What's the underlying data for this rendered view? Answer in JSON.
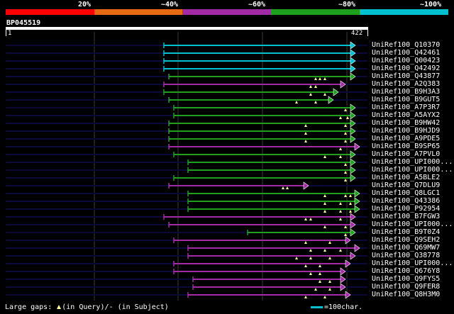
{
  "scale": {
    "labels": [
      "20%",
      "~40%",
      "~60%",
      "~80%",
      "~100%"
    ],
    "colors": [
      "#ff0000",
      "#e66a14",
      "#a32aa5",
      "#1ea01e",
      "#00bfcf"
    ]
  },
  "query": {
    "id": "BP045519",
    "start": "1",
    "end": "422",
    "length": 422
  },
  "hits": [
    {
      "name": "UniRef100_Q10370",
      "color": "#00bfcf",
      "start": 231,
      "end": 494,
      "gaps": []
    },
    {
      "name": "UniRef100_Q42461",
      "color": "#00bfcf",
      "start": 231,
      "end": 494,
      "gaps": []
    },
    {
      "name": "UniRef100_Q00423",
      "color": "#00bfcf",
      "start": 231,
      "end": 494,
      "gaps": []
    },
    {
      "name": "UniRef100_Q42492",
      "color": "#00bfcf",
      "start": 231,
      "end": 494,
      "gaps": []
    },
    {
      "name": "UniRef100_Q43877",
      "color": "#1ea01e",
      "start": 238,
      "end": 494,
      "gaps": [
        445,
        451,
        458
      ]
    },
    {
      "name": "UniRef100_A2Q383",
      "color": "#a32aa5",
      "start": 231,
      "end": 480,
      "gaps": [
        438,
        445
      ]
    },
    {
      "name": "UniRef100_B9H3A3",
      "color": "#1ea01e",
      "start": 231,
      "end": 470,
      "gaps": [
        438,
        458
      ]
    },
    {
      "name": "UniRef100_B9GUT5",
      "color": "#1ea01e",
      "start": 238,
      "end": 463,
      "gaps": [
        418,
        445
      ]
    },
    {
      "name": "UniRef100_A7P3R7",
      "color": "#1ea01e",
      "start": 245,
      "end": 494,
      "gaps": [
        487
      ]
    },
    {
      "name": "UniRef100_A5AYX2",
      "color": "#1ea01e",
      "start": 245,
      "end": 494,
      "gaps": [
        480,
        490
      ]
    },
    {
      "name": "UniRef100_B9HW42",
      "color": "#1ea01e",
      "start": 238,
      "end": 494,
      "gaps": [
        431,
        487
      ]
    },
    {
      "name": "UniRef100_B9HJD9",
      "color": "#1ea01e",
      "start": 238,
      "end": 494,
      "gaps": [
        431,
        487
      ]
    },
    {
      "name": "UniRef100_A9PDE5",
      "color": "#1ea01e",
      "start": 238,
      "end": 494,
      "gaps": [
        431,
        487
      ]
    },
    {
      "name": "UniRef100_B9SP65",
      "color": "#a32aa5",
      "start": 238,
      "end": 500,
      "gaps": [
        480
      ]
    },
    {
      "name": "UniRef100_A7PVL0",
      "color": "#1ea01e",
      "start": 245,
      "end": 494,
      "gaps": [
        458,
        480
      ]
    },
    {
      "name": "UniRef100_UPI000...",
      "color": "#1ea01e",
      "start": 265,
      "end": 494,
      "gaps": [
        487
      ]
    },
    {
      "name": "UniRef100_UPI000...",
      "color": "#1ea01e",
      "start": 265,
      "end": 494,
      "gaps": [
        487
      ]
    },
    {
      "name": "UniRef100_A5BLE2",
      "color": "#1ea01e",
      "start": 245,
      "end": 494,
      "gaps": [
        487
      ]
    },
    {
      "name": "UniRef100_Q7DLU9",
      "color": "#a32aa5",
      "start": 238,
      "end": 428,
      "gaps": [
        399,
        405
      ]
    },
    {
      "name": "UniRef100_Q8LGC1",
      "color": "#1ea01e",
      "start": 265,
      "end": 500,
      "gaps": [
        458,
        487,
        494
      ]
    },
    {
      "name": "UniRef100_Q43386",
      "color": "#1ea01e",
      "start": 265,
      "end": 500,
      "gaps": [
        458,
        480,
        494
      ]
    },
    {
      "name": "UniRef100_P92954",
      "color": "#1ea01e",
      "start": 265,
      "end": 500,
      "gaps": [
        458,
        480,
        494
      ]
    },
    {
      "name": "UniRef100_B7FGW3",
      "color": "#a32aa5",
      "start": 231,
      "end": 494,
      "gaps": [
        431,
        438,
        480
      ]
    },
    {
      "name": "UniRef100_UPI000...",
      "color": "#a32aa5",
      "start": 238,
      "end": 494,
      "gaps": [
        458,
        487
      ]
    },
    {
      "name": "UniRef100_B9T0Z4",
      "color": "#1ea01e",
      "start": 349,
      "end": 494,
      "gaps": [
        487
      ]
    },
    {
      "name": "UniRef100_Q9SEH2",
      "color": "#a32aa5",
      "start": 245,
      "end": 487,
      "gaps": [
        431,
        465
      ]
    },
    {
      "name": "UniRef100_Q69MW7",
      "color": "#a32aa5",
      "start": 265,
      "end": 500,
      "gaps": [
        438,
        458,
        480
      ]
    },
    {
      "name": "UniRef100_Q38778",
      "color": "#a32aa5",
      "start": 265,
      "end": 494,
      "gaps": [
        418,
        438,
        465
      ]
    },
    {
      "name": "UniRef100_UPI000...",
      "color": "#a32aa5",
      "start": 245,
      "end": 487,
      "gaps": [
        431,
        451
      ]
    },
    {
      "name": "UniRef100_Q676Y8",
      "color": "#a32aa5",
      "start": 245,
      "end": 480,
      "gaps": [
        438,
        451
      ]
    },
    {
      "name": "UniRef100_Q9FYS5",
      "color": "#a32aa5",
      "start": 272,
      "end": 480,
      "gaps": [
        451,
        465
      ]
    },
    {
      "name": "UniRef100_Q9FER8",
      "color": "#a32aa5",
      "start": 272,
      "end": 480,
      "gaps": [
        445,
        465
      ]
    },
    {
      "name": "UniRef100_Q8H3M0",
      "color": "#a32aa5",
      "start": 265,
      "end": 487,
      "gaps": [
        431,
        458
      ]
    }
  ],
  "footer": {
    "label": "Large gaps:",
    "query_text": "(in Query)/",
    "subject_dash": "-",
    "subject_text": "(in Subject)"
  },
  "legend": {
    "text": "=100char."
  }
}
